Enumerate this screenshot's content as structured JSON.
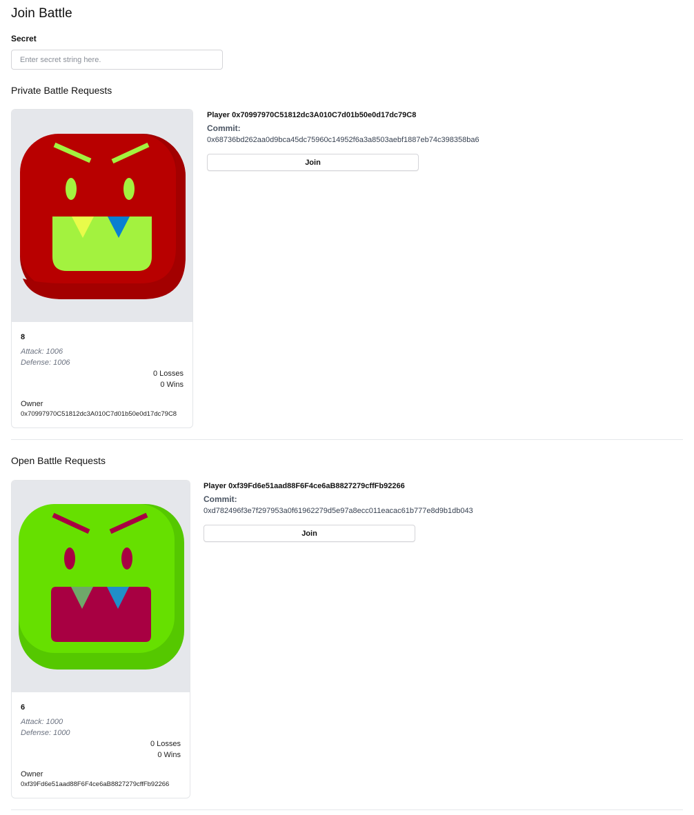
{
  "page": {
    "title": "Join Battle"
  },
  "secret": {
    "label": "Secret",
    "placeholder": "Enter secret string here.",
    "value": ""
  },
  "private_section": {
    "title": "Private Battle Requests",
    "request": {
      "player_line": "Player 0x70997970C51812dc3A010C7d01b50e0d17dc79C8",
      "commit_label": "Commit:",
      "commit_hash": "0x68736bd262aa0d9bca45dc75960c14952f6a3a8503aebf1887eb74c398358ba6",
      "join_label": "Join"
    },
    "monster": {
      "id": "8",
      "attack": "Attack: 1006",
      "defense": "Defense: 1006",
      "losses": "0 Losses",
      "wins": "0 Wins",
      "owner_label": "Owner",
      "owner_address": "0x70997970C51812dc3A010C7d01b50e0d17dc79C8",
      "colors": {
        "body": "#b80000",
        "body_shadow": "#a00000",
        "features": "#a3f23f",
        "fang_left": "#e8fb4a",
        "fang_right": "#0a7fd1"
      }
    }
  },
  "open_section": {
    "title": "Open Battle Requests",
    "request": {
      "player_line": "Player 0xf39Fd6e51aad88F6F4ce6aB8827279cffFb92266",
      "commit_label": "Commit:",
      "commit_hash": "0xd782496f3e7f297953a0f61962279d5e97a8ecc011eacac61b777e8d9b1db043",
      "join_label": "Join"
    },
    "monster": {
      "id": "6",
      "attack": "Attack: 1000",
      "defense": "Defense: 1000",
      "losses": "0 Losses",
      "wins": "0 Wins",
      "owner_label": "Owner",
      "owner_address": "0xf39Fd6e51aad88F6F4ce6aB8827279cffFb92266",
      "colors": {
        "body": "#66e000",
        "body_shadow": "#55c800",
        "features": "#a80042",
        "fang_left": "#6fa86a",
        "fang_right": "#1f8fc9"
      }
    }
  }
}
